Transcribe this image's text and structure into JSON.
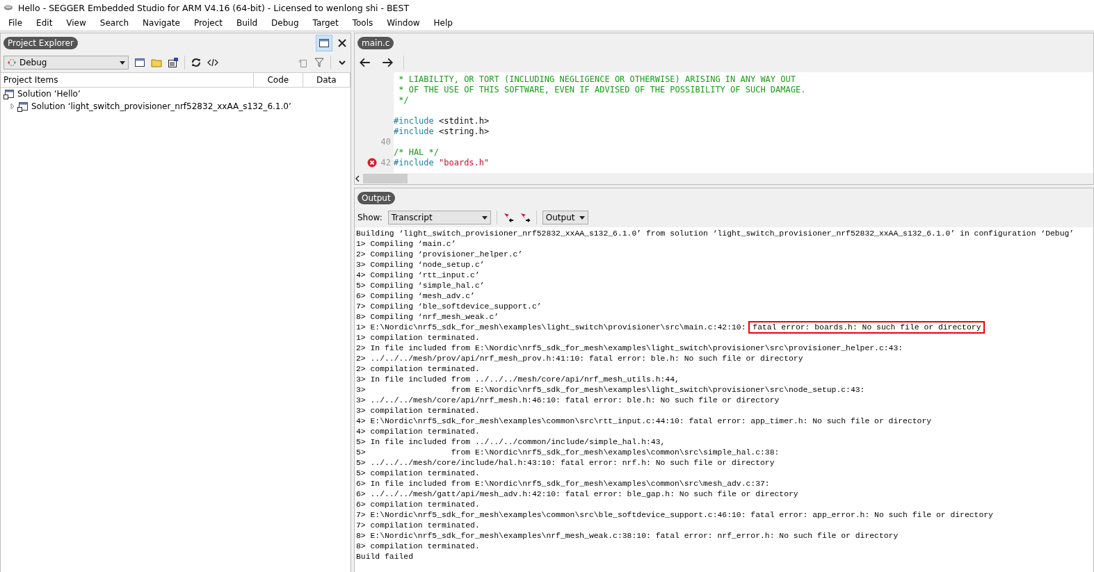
{
  "window": {
    "title": "Hello - SEGGER Embedded Studio for ARM V4.16 (64-bit) - Licensed to wenlong shi - BEST"
  },
  "menu": [
    "File",
    "Edit",
    "View",
    "Search",
    "Navigate",
    "Project",
    "Build",
    "Debug",
    "Target",
    "Tools",
    "Window",
    "Help"
  ],
  "project_explorer": {
    "title": "Project Explorer",
    "configuration": "Debug",
    "columns": [
      "Project Items",
      "Code",
      "Data"
    ],
    "tree": [
      {
        "label": "Solution ‘Hello’",
        "children": [
          {
            "label": "Solution ‘light_switch_provisioner_nrf52832_xxAA_s132_6.1.0’",
            "expanded": false
          }
        ]
      }
    ]
  },
  "editor": {
    "tab": "main.c",
    "lines": [
      {
        "error": false,
        "tokens": [
          {
            "kind": "comment",
            "text": " * LIABILITY, OR TORT (INCLUDING NEGLIGENCE OR OTHERWISE) ARISING IN ANY WAY OUT"
          }
        ]
      },
      {
        "error": false,
        "tokens": [
          {
            "kind": "comment",
            "text": " * OF THE USE OF THIS SOFTWARE, EVEN IF ADVISED OF THE POSSIBILITY OF SUCH DAMAGE."
          }
        ]
      },
      {
        "error": false,
        "tokens": [
          {
            "kind": "comment",
            "text": " */"
          }
        ]
      },
      {
        "error": false
      },
      {
        "error": false,
        "tokens": [
          {
            "kind": "directive",
            "text": "#include"
          },
          {
            "kind": "plain",
            "text": " <stdint.h>"
          }
        ]
      },
      {
        "error": false,
        "tokens": [
          {
            "kind": "directive",
            "text": "#include"
          },
          {
            "kind": "plain",
            "text": " <string.h>"
          }
        ]
      },
      {
        "number": "40",
        "error": false
      },
      {
        "error": false,
        "tokens": [
          {
            "kind": "comment",
            "text": "/* HAL */"
          }
        ]
      },
      {
        "number": "42",
        "error": true,
        "tokens": [
          {
            "kind": "directive",
            "text": "#include"
          },
          {
            "kind": "string",
            "text": " \"boards.h\""
          }
        ]
      }
    ]
  },
  "output": {
    "title": "Output",
    "show_label": "Show:",
    "show": "Transcript",
    "target": "Output",
    "lines": [
      {
        "text": "Building ‘light_switch_provisioner_nrf52832_xxAA_s132_6.1.0’ from solution ‘light_switch_provisioner_nrf52832_xxAA_s132_6.1.0’ in configuration ‘Debug’"
      },
      {
        "text": "1> Compiling ‘main.c’"
      },
      {
        "text": "2> Compiling ‘provisioner_helper.c’"
      },
      {
        "text": "3> Compiling ‘node_setup.c’"
      },
      {
        "text": "4> Compiling ‘rtt_input.c’"
      },
      {
        "text": "5> Compiling ‘simple_hal.c’"
      },
      {
        "text": "6> Compiling ‘mesh_adv.c’"
      },
      {
        "text": "7> Compiling ‘ble_softdevice_support.c’"
      },
      {
        "text": "8> Compiling ‘nrf_mesh_weak.c’"
      },
      {
        "text": "1> E:\\Nordic\\nrf5_sdk_for_mesh\\examples\\light_switch\\provisioner\\src\\main.c:42:10: ",
        "boxed": "fatal error: boards.h: No such file or directory"
      },
      {
        "text": "1> compilation terminated."
      },
      {
        "text": "2> In file included from E:\\Nordic\\nrf5_sdk_for_mesh\\examples\\light_switch\\provisioner\\src\\provisioner_helper.c:43:"
      },
      {
        "text": "2> ../../../mesh/prov/api/nrf_mesh_prov.h:41:10: fatal error: ble.h: No such file or directory"
      },
      {
        "text": "2> compilation terminated."
      },
      {
        "text": "3> In file included from ../../../mesh/core/api/nrf_mesh_utils.h:44,"
      },
      {
        "text": "3>                  from E:\\Nordic\\nrf5_sdk_for_mesh\\examples\\light_switch\\provisioner\\src\\node_setup.c:43:"
      },
      {
        "text": "3> ../../../mesh/core/api/nrf_mesh.h:46:10: fatal error: ble.h: No such file or directory"
      },
      {
        "text": "3> compilation terminated."
      },
      {
        "text": "4> E:\\Nordic\\nrf5_sdk_for_mesh\\examples\\common\\src\\rtt_input.c:44:10: fatal error: app_timer.h: No such file or directory"
      },
      {
        "text": "4> compilation terminated."
      },
      {
        "text": "5> In file included from ../../../common/include/simple_hal.h:43,"
      },
      {
        "text": "5>                  from E:\\Nordic\\nrf5_sdk_for_mesh\\examples\\common\\src\\simple_hal.c:38:"
      },
      {
        "text": "5> ../../../mesh/core/include/hal.h:43:10: fatal error: nrf.h: No such file or directory"
      },
      {
        "text": "5> compilation terminated."
      },
      {
        "text": "6> In file included from E:\\Nordic\\nrf5_sdk_for_mesh\\examples\\common\\src\\mesh_adv.c:37:"
      },
      {
        "text": "6> ../../../mesh/gatt/api/mesh_adv.h:42:10: fatal error: ble_gap.h: No such file or directory"
      },
      {
        "text": "6> compilation terminated."
      },
      {
        "text": "7> E:\\Nordic\\nrf5_sdk_for_mesh\\examples\\common\\src\\ble_softdevice_support.c:46:10: fatal error: app_error.h: No such file or directory"
      },
      {
        "text": "7> compilation terminated."
      },
      {
        "text": "8> E:\\Nordic\\nrf5_sdk_for_mesh\\examples\\nrf_mesh_weak.c:38:10: fatal error: nrf_error.h: No such file or directory"
      },
      {
        "text": "8> compilation terminated."
      },
      {
        "text": "Build failed"
      }
    ]
  }
}
